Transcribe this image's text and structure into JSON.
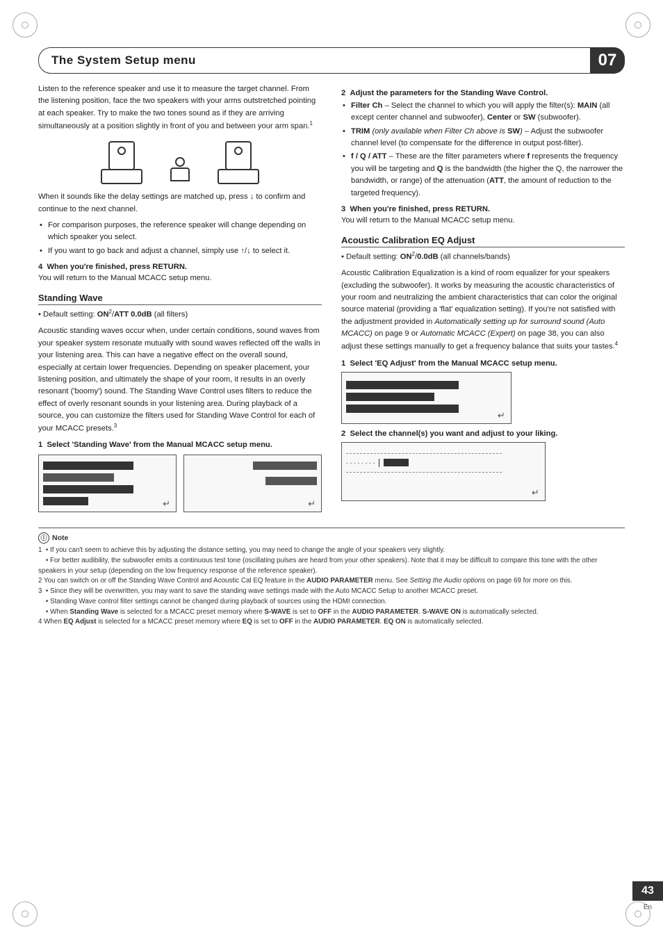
{
  "header": {
    "title": "The System Setup menu",
    "chapter": "07"
  },
  "page": {
    "number": "43",
    "lang": "En"
  },
  "intro": {
    "text": "Listen to the reference speaker and use it to measure the target channel. From the listening position, face the two speakers with your arms outstretched pointing at each speaker. Try to make the two tones sound as if they are arriving simultaneously at a position slightly in front of you and between your arm span.",
    "footnote": "1"
  },
  "after_diagram": {
    "text": "When it sounds like the delay settings are matched up, press ↓ to confirm and continue to the next channel.",
    "bullets": [
      "For comparison purposes, the reference speaker will change depending on which speaker you select.",
      "If you want to go back and adjust a channel, simply use ↑/↓ to select it."
    ]
  },
  "step4": {
    "label": "4",
    "text": "When you're finished, press RETURN.",
    "sub": "You will return to the Manual MCACC setup menu."
  },
  "standing_wave": {
    "heading": "Standing Wave",
    "default_setting": "Default setting: ON²/ATT 0.0dB (all filters)",
    "body1": "Acoustic standing waves occur when, under certain conditions, sound waves from your speaker system resonate mutually with sound waves reflected off the walls in your listening area. This can have a negative effect on the overall sound, especially at certain lower frequencies. Depending on speaker placement, your listening position, and ultimately the shape of your room, it results in an overly resonant ('boomy') sound. The Standing Wave Control uses filters to reduce the effect of overly resonant sounds in your listening area. During playback of a source, you can customize the filters used for Standing Wave Control for each of your MCACC presets.",
    "footnote": "3",
    "step1": {
      "label": "1",
      "text": "Select 'Standing Wave' from the Manual MCACC setup menu."
    }
  },
  "right_col": {
    "step2_heading": "2  Adjust the parameters for the Standing Wave Control.",
    "bullets": [
      "Filter Ch – Select the channel to which you will apply the filter(s): MAIN (all except center channel and subwoofer), Center or SW (subwoofer).",
      "TRIM (only available when Filter Ch above is SW) – Adjust the subwoofer channel level (to compensate for the difference in output post-filter).",
      "f / Q / ATT – These are the filter parameters where f represents the frequency you will be targeting and Q is the bandwidth (the higher the Q, the narrower the bandwidth, or range) of the attenuation (ATT, the amount of reduction to the targeted frequency)."
    ],
    "step3": {
      "label": "3",
      "text": "When you're finished, press RETURN.",
      "sub": "You will return to the Manual MCACC setup menu."
    },
    "acoustic_eq": {
      "heading": "Acoustic Calibration EQ Adjust",
      "default_setting": "Default setting: ON²/0.0dB (all channels/bands)",
      "body": "Acoustic Calibration Equalization is a kind of room equalizer for your speakers (excluding the subwoofer). It works by measuring the acoustic characteristics of your room and neutralizing the ambient characteristics that can color the original source material (providing a 'flat' equalization setting). If you're not satisfied with the adjustment provided in Automatically setting up for surround sound (Auto MCACC) on page 9 or Automatic MCACC (Expert) on page 38, you can also adjust these settings manually to get a frequency balance that suits your tastes.",
      "footnote": "4",
      "step1": {
        "label": "1",
        "text": "Select 'EQ Adjust' from the Manual MCACC setup menu."
      },
      "step2": {
        "label": "2",
        "text": "Select the channel(s) you want and adjust to your liking."
      }
    }
  },
  "note": {
    "label": "Note",
    "items": [
      "• If you can't seem to achieve this by adjusting the distance setting, you may need to change the angle of your speakers very slightly.",
      "• For better audibility, the subwoofer emits a continuous test tone (oscillating pulses are heard from your other speakers). Note that it may be difficult to compare this tone with the other speakers in your setup (depending on the low frequency response of the reference speaker).",
      "2 You can switch on or off the Standing Wave Control and Acoustic Cal EQ feature in the AUDIO PARAMETER menu. See Setting the Audio options on page 69 for more on this.",
      "3 • Since they will be overwritten, you may want to save the standing wave settings made with the Auto MCACC Setup to another MCACC preset.",
      "• Standing Wave control filter settings cannot be changed during playback of sources using the HDMI connection.",
      "• When Standing Wave is selected for a MCACC preset memory where S-WAVE is set to OFF in the AUDIO PARAMETER. S-WAVE ON is automatically selected.",
      "4 When EQ Adjust is selected for a MCACC preset memory where EQ is set to OFF in the AUDIO PARAMETER. EQ ON is automatically selected."
    ]
  }
}
